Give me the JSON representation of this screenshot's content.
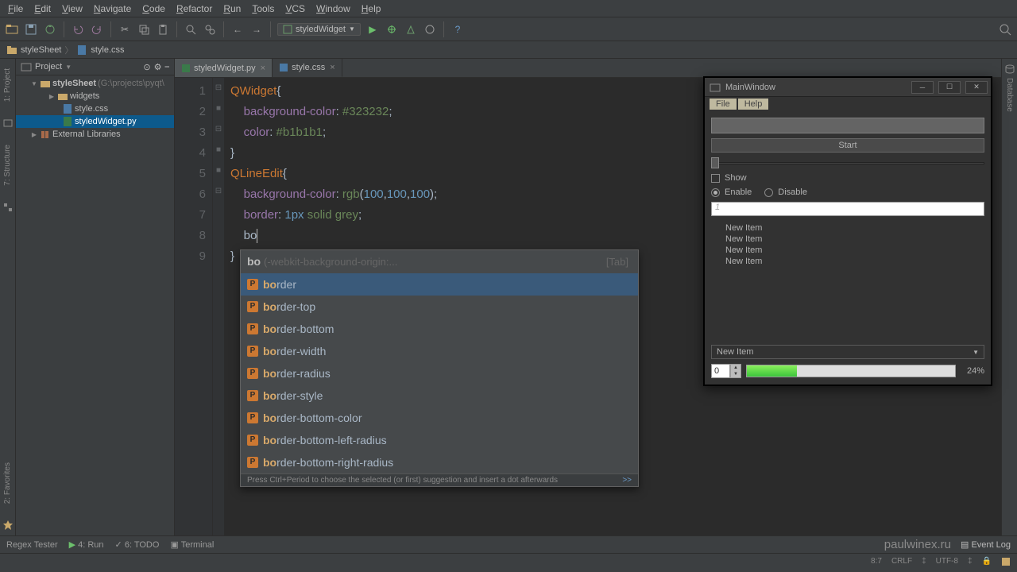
{
  "menubar": [
    "File",
    "Edit",
    "View",
    "Navigate",
    "Code",
    "Refactor",
    "Run",
    "Tools",
    "VCS",
    "Window",
    "Help"
  ],
  "run_config": "styledWidget",
  "crumbs": {
    "folder": "styleSheet",
    "file": "style.css"
  },
  "left_rail": [
    "1: Project",
    "7: Structure",
    "2: Favorites"
  ],
  "right_rail": "Database",
  "project": {
    "title": "Project",
    "root": "styleSheet",
    "root_hint": "(G:\\projects\\pyqt\\",
    "children": [
      {
        "name": "widgets",
        "type": "folder"
      },
      {
        "name": "style.css",
        "type": "css"
      },
      {
        "name": "styledWidget.py",
        "type": "py",
        "selected": true
      }
    ],
    "external": "External Libraries"
  },
  "tabs": [
    {
      "name": "styledWidget.py",
      "type": "py"
    },
    {
      "name": "style.css",
      "type": "css",
      "active": true
    }
  ],
  "code": {
    "lines": [
      1,
      2,
      3,
      4,
      5,
      6,
      7,
      8,
      9
    ],
    "l1_sel": "QWidget",
    "l1_brace": "{",
    "l2_prop": "background-color",
    "l2_val": "#323232",
    "l3_prop": "color",
    "l3_val": "#b1b1b1",
    "l4": "}",
    "l5_sel": "QLineEdit",
    "l5_brace": "{",
    "l6_prop": "background-color",
    "l6_val_fn": "rgb",
    "l6_n1": "100",
    "l6_n2": "100",
    "l6_n3": "100",
    "l7_prop": "border",
    "l7_num": "1px",
    "l7_v1": "solid",
    "l7_v2": "grey",
    "l8_typed": "bo",
    "l9": "}"
  },
  "autocomplete": {
    "typed": "bo",
    "hint": "(-webkit-background-origin:...",
    "tab": "[Tab]",
    "items": [
      "border",
      "border-top",
      "border-bottom",
      "border-width",
      "border-radius",
      "border-style",
      "border-bottom-color",
      "border-bottom-left-radius",
      "border-bottom-right-radius"
    ],
    "selected": 0,
    "footer": "Press Ctrl+Period to choose the selected (or first) suggestion and insert a dot afterwards",
    "footer_more": ">>"
  },
  "bottom_tabs": {
    "regex": "Regex Tester",
    "run": "4: Run",
    "todo": "6: TODO",
    "terminal": "Terminal",
    "eventlog": "Event Log"
  },
  "site": "paulwinex.ru",
  "status": {
    "pos": "8:7",
    "sep": "CRLF",
    "enc": "UTF-8"
  },
  "qt": {
    "title": "MainWindow",
    "menu": [
      "File",
      "Help"
    ],
    "start": "Start",
    "show": "Show",
    "enable": "Enable",
    "disable": "Disable",
    "field_hint": "1",
    "list": [
      "New Item",
      "New Item",
      "New Item",
      "New Item"
    ],
    "combo": "New Item",
    "spin": "0",
    "pct": "24%"
  }
}
